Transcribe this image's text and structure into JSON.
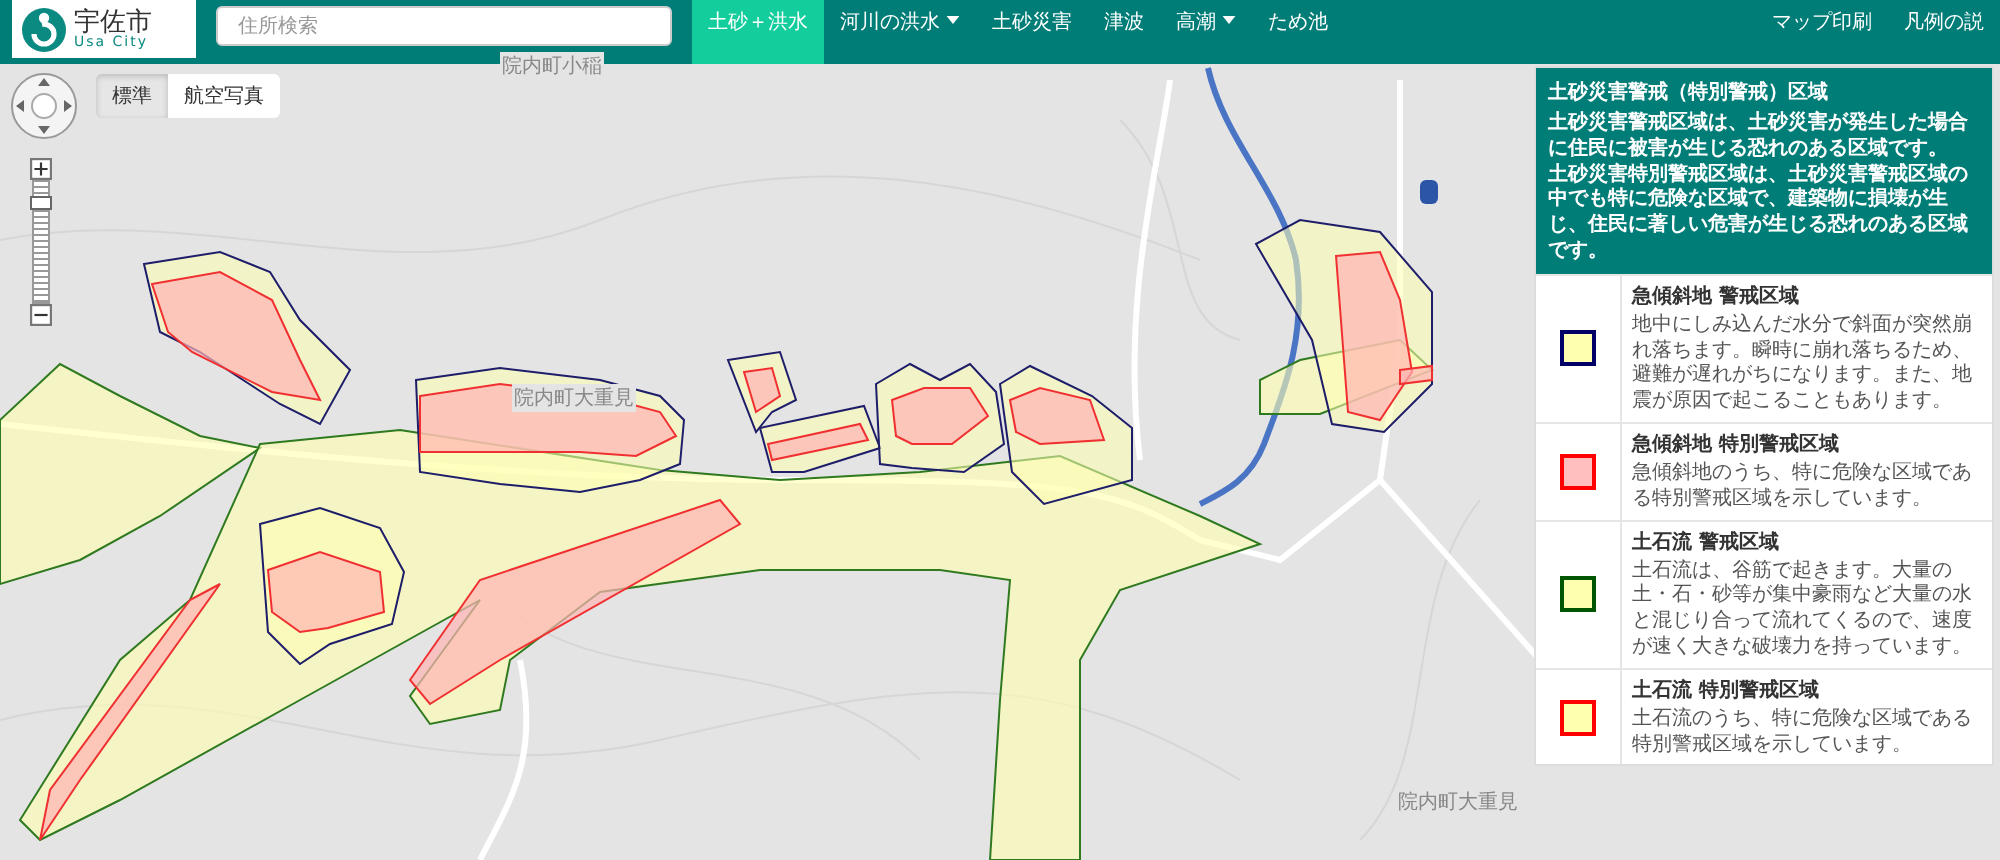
{
  "header": {
    "logo": {
      "name": "宇佐市",
      "subtitle": "Usa City"
    },
    "search": {
      "placeholder": "住所検索"
    },
    "nav": [
      {
        "label": "土砂＋洪水",
        "selected": true,
        "dropdown": false
      },
      {
        "label": "河川の洪水",
        "selected": false,
        "dropdown": true
      },
      {
        "label": "土砂災害",
        "selected": false,
        "dropdown": false
      },
      {
        "label": "津波",
        "selected": false,
        "dropdown": false
      },
      {
        "label": "高潮",
        "selected": false,
        "dropdown": true
      },
      {
        "label": "ため池",
        "selected": false,
        "dropdown": false
      }
    ],
    "nav_right": [
      "マップ印刷",
      "凡例の説"
    ]
  },
  "map": {
    "base_layers": [
      {
        "label": "標準",
        "selected": true
      },
      {
        "label": "航空写真",
        "selected": false
      }
    ],
    "zoom": {
      "level": 0.85
    },
    "place_labels": [
      "院内町小稲",
      "院内町大重見",
      "院内町大重見"
    ]
  },
  "legend": {
    "title": "土砂災害警戒（特別警戒）区域",
    "description": [
      "土砂災害警戒区域は、土砂災害が発生した場合に住民に被害が生じる恐れのある区域です。",
      "土砂災害特別警戒区域は、土砂災害警戒区域の中でも特に危険な区域で、建築物に損壊が生じ、住民に著しい危害が生じる恐れのある区域です。"
    ],
    "items": [
      {
        "title": "急傾斜地 警戒区域",
        "description": "地中にしみ込んだ水分で斜面が突然崩れ落ちます。瞬時に崩れ落ちるため、避難が遅れがちになります。また、地震が原因で起こることもあります。",
        "color": "#000066",
        "shaded": false
      },
      {
        "title": "急傾斜地 特別警戒区域",
        "description": "急傾斜地のうち、特に危険な区域である特別警戒区域を示しています。",
        "color": "#ff0000",
        "shaded": true
      },
      {
        "title": "土石流 警戒区域",
        "description": "土石流は、谷筋で起きます。大量の土・石・砂等が集中豪雨など大量の水と混じり合って流れてくるので、速度が速く大きな破壊力を持っています。",
        "color": "#005500",
        "shaded": false
      },
      {
        "title": "土石流 特別警戒区域",
        "description": "土石流のうち、特に危険な区域である特別警戒区域を示しています。",
        "color": "#ff0000",
        "shaded": false
      }
    ]
  }
}
